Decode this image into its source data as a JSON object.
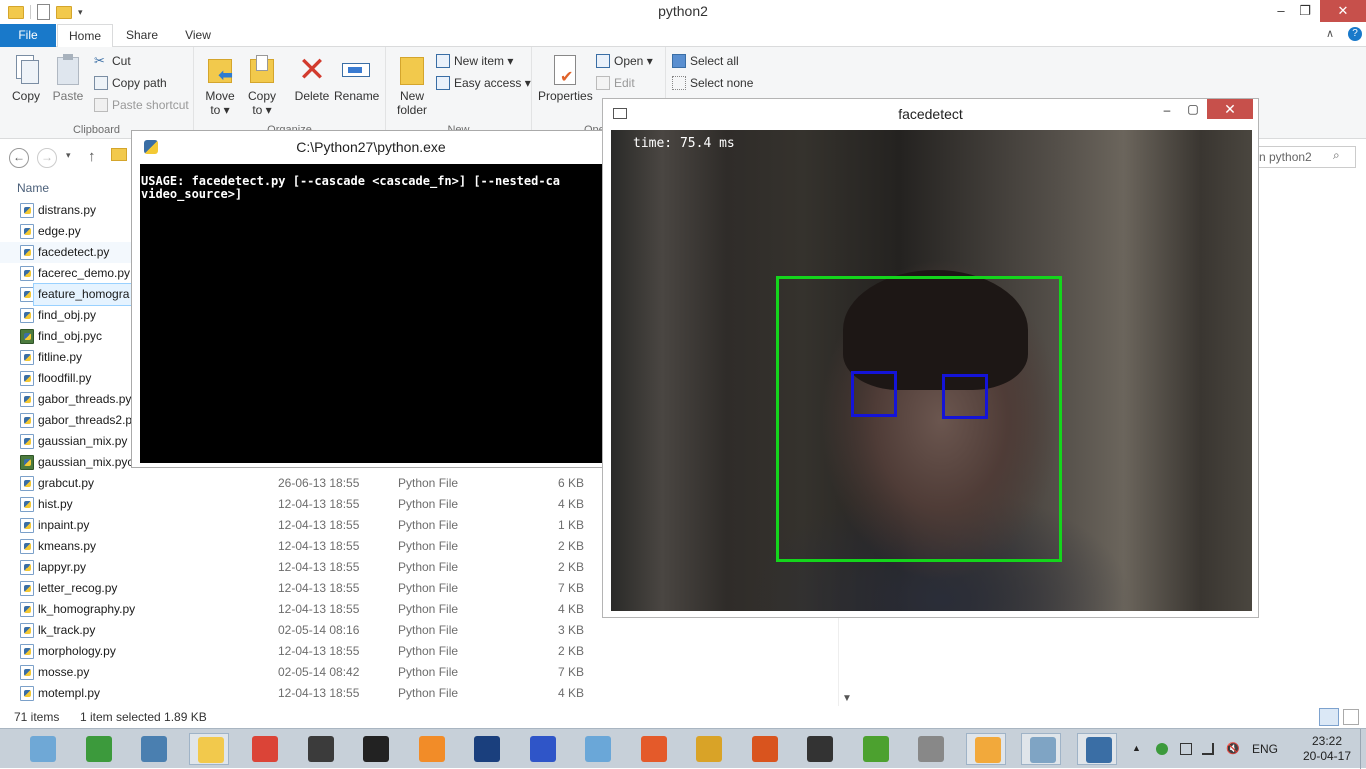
{
  "explorer": {
    "title": "python2",
    "tabs": {
      "file": "File",
      "home": "Home",
      "share": "Share",
      "view": "View"
    },
    "ribbon": {
      "clipboard": {
        "label": "Clipboard",
        "copy": "Copy",
        "paste": "Paste",
        "cut": "Cut",
        "copy_path": "Copy path",
        "paste_shortcut": "Paste shortcut"
      },
      "organize": {
        "label": "Organize",
        "move_to": [
          "Move",
          "to ▾"
        ],
        "copy_to": [
          "Copy",
          "to ▾"
        ],
        "delete": "Delete",
        "rename": "Rename"
      },
      "new": {
        "label": "New",
        "new_folder": [
          "New",
          "folder"
        ],
        "new_item": "New item ▾",
        "easy_access": "Easy access ▾"
      },
      "open": {
        "label": "Ope",
        "properties": "Properties",
        "open": "Open ▾",
        "edit": "Edit"
      },
      "select": {
        "select_all": "Select all",
        "select_none": "Select none"
      }
    },
    "search_placeholder": "n python2",
    "column_name": "Name",
    "files": [
      {
        "name": "distrans.py",
        "date": "",
        "type": "",
        "size": "",
        "kind": "py"
      },
      {
        "name": "edge.py",
        "date": "",
        "type": "",
        "size": "",
        "kind": "py"
      },
      {
        "name": "facedetect.py",
        "date": "",
        "type": "",
        "size": "",
        "kind": "py",
        "state": "hl"
      },
      {
        "name": "facerec_demo.py",
        "date": "",
        "type": "",
        "size": "",
        "kind": "py"
      },
      {
        "name": "feature_homogra",
        "date": "",
        "type": "",
        "size": "",
        "kind": "py",
        "state": "sel"
      },
      {
        "name": "find_obj.py",
        "date": "",
        "type": "",
        "size": "",
        "kind": "py"
      },
      {
        "name": "find_obj.pyc",
        "date": "",
        "type": "",
        "size": "",
        "kind": "pyc"
      },
      {
        "name": "fitline.py",
        "date": "",
        "type": "",
        "size": "",
        "kind": "py"
      },
      {
        "name": "floodfill.py",
        "date": "",
        "type": "",
        "size": "",
        "kind": "py"
      },
      {
        "name": "gabor_threads.py",
        "date": "",
        "type": "",
        "size": "",
        "kind": "py"
      },
      {
        "name": "gabor_threads2.py",
        "date": "",
        "type": "",
        "size": "",
        "kind": "py"
      },
      {
        "name": "gaussian_mix.py",
        "date": "",
        "type": "",
        "size": "",
        "kind": "py"
      },
      {
        "name": "gaussian_mix.pyc",
        "date": "",
        "type": "",
        "size": "",
        "kind": "pyc"
      },
      {
        "name": "grabcut.py",
        "date": "26-06-13 18:55",
        "type": "Python File",
        "size": "6 KB",
        "kind": "py"
      },
      {
        "name": "hist.py",
        "date": "12-04-13 18:55",
        "type": "Python File",
        "size": "4 KB",
        "kind": "py"
      },
      {
        "name": "inpaint.py",
        "date": "12-04-13 18:55",
        "type": "Python File",
        "size": "1 KB",
        "kind": "py"
      },
      {
        "name": "kmeans.py",
        "date": "12-04-13 18:55",
        "type": "Python File",
        "size": "2 KB",
        "kind": "py"
      },
      {
        "name": "lappyr.py",
        "date": "12-04-13 18:55",
        "type": "Python File",
        "size": "2 KB",
        "kind": "py"
      },
      {
        "name": "letter_recog.py",
        "date": "12-04-13 18:55",
        "type": "Python File",
        "size": "7 KB",
        "kind": "py"
      },
      {
        "name": "lk_homography.py",
        "date": "12-04-13 18:55",
        "type": "Python File",
        "size": "4 KB",
        "kind": "py"
      },
      {
        "name": "lk_track.py",
        "date": "02-05-14 08:16",
        "type": "Python File",
        "size": "3 KB",
        "kind": "py"
      },
      {
        "name": "morphology.py",
        "date": "12-04-13 18:55",
        "type": "Python File",
        "size": "2 KB",
        "kind": "py"
      },
      {
        "name": "mosse.py",
        "date": "02-05-14 08:42",
        "type": "Python File",
        "size": "7 KB",
        "kind": "py"
      },
      {
        "name": "motempl.py",
        "date": "12-04-13 18:55",
        "type": "Python File",
        "size": "4 KB",
        "kind": "py"
      }
    ],
    "status": {
      "items": "71 items",
      "selected": "1 item selected  1.89 KB"
    }
  },
  "console": {
    "title": "C:\\Python27\\python.exe",
    "output": "USAGE: facedetect.py [--cascade <cascade_fn>] [--nested-ca\nvideo_source>]"
  },
  "facedetect": {
    "title": "facedetect",
    "time_readout": "time: 75.4 ms",
    "face_box_color": "#14d51c",
    "eye_box_color": "#1414d8"
  },
  "taskbar": {
    "apps": [
      {
        "icon": "desktop-app-icon",
        "color": "#6fa8d6"
      },
      {
        "icon": "nt-app-icon",
        "color": "#3c9a3c"
      },
      {
        "icon": "window-app-icon",
        "color": "#4a7fb0"
      },
      {
        "icon": "file-explorer-icon",
        "color": "#f2c94c",
        "active": true
      },
      {
        "icon": "chrome-icon",
        "color": "#db4437"
      },
      {
        "icon": "sublime-text-icon",
        "color": "#3b3b3b"
      },
      {
        "icon": "tool-app-icon",
        "color": "#222222"
      },
      {
        "icon": "fl-studio-icon",
        "color": "#f28c28"
      },
      {
        "icon": "visual-studio-icon",
        "color": "#1a3f7d"
      },
      {
        "icon": "diagram-app-icon",
        "color": "#2f55c8"
      },
      {
        "icon": "feather-app-icon",
        "color": "#6aa7d8"
      },
      {
        "icon": "grid-app-icon",
        "color": "#e45a2a"
      },
      {
        "icon": "winamp-icon",
        "color": "#d9a327"
      },
      {
        "icon": "matlab-icon",
        "color": "#d9541e"
      },
      {
        "icon": "unity-icon",
        "color": "#333333"
      },
      {
        "icon": "utorrent-icon",
        "color": "#4ca12f"
      },
      {
        "icon": "console-app-icon",
        "color": "#888888"
      },
      {
        "icon": "search-app-icon",
        "color": "#f2a93b",
        "active": true
      },
      {
        "icon": "monitor-app-icon",
        "color": "#7fa4c4",
        "active": true
      },
      {
        "icon": "python-icon",
        "color": "#3a6ea5",
        "active": true
      }
    ],
    "language": "ENG",
    "time": "23:22",
    "date": "20-04-17"
  }
}
